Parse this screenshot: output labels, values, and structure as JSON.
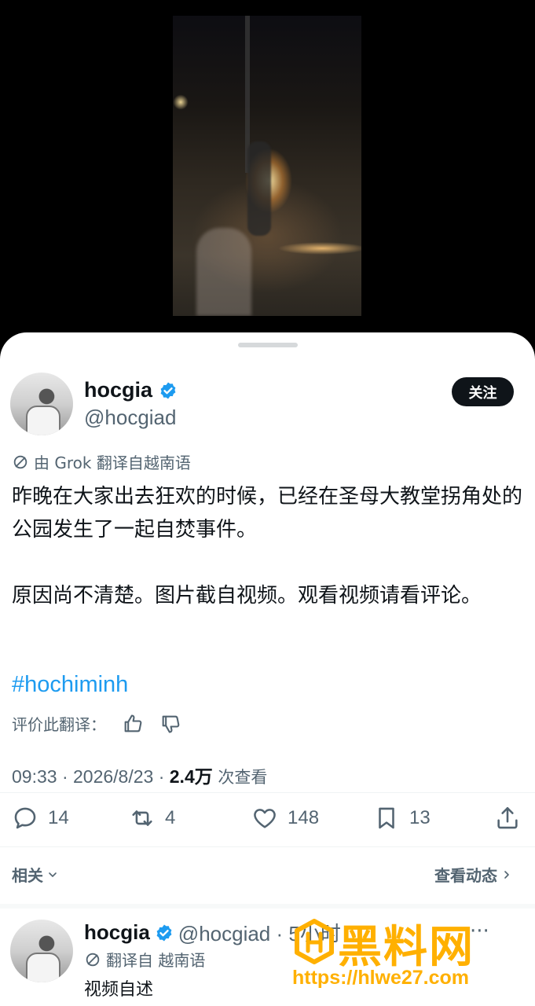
{
  "tweet": {
    "display_name": "hocgia",
    "handle": "@hocgiad",
    "follow_label": "关注",
    "translate_note": "由 Grok 翻译自越南语",
    "paragraphs": [
      "昨晚在大家出去狂欢的时候，已经在圣母大教堂拐角处的公园发生了一起自焚事件。",
      "原因尚不清楚。图片截自视频。观看视频请看评论。"
    ],
    "hashtag": "#hochiminh",
    "rate_label": "评价此翻译：",
    "timestamp": "09:33 · 2026/8/23 · ",
    "views_count": "2.4万",
    "views_label": " 次查看",
    "actions": {
      "replies": "14",
      "retweets": "4",
      "likes": "148",
      "bookmarks": "13"
    }
  },
  "related": {
    "label": "相关",
    "see_activity": "查看动态"
  },
  "reply": {
    "display_name": "hocgia",
    "handle": "@hocgiad · 5小时",
    "more": "···",
    "translate_note": "翻译自 越南语",
    "text": "视频自述"
  },
  "watermark": {
    "title": "黑料网",
    "url": "https://hlwe27.com"
  },
  "colors": {
    "accent": "#1d9bf0",
    "text": "#0f1419",
    "secondary": "#536471",
    "watermark": "#ffb000"
  }
}
